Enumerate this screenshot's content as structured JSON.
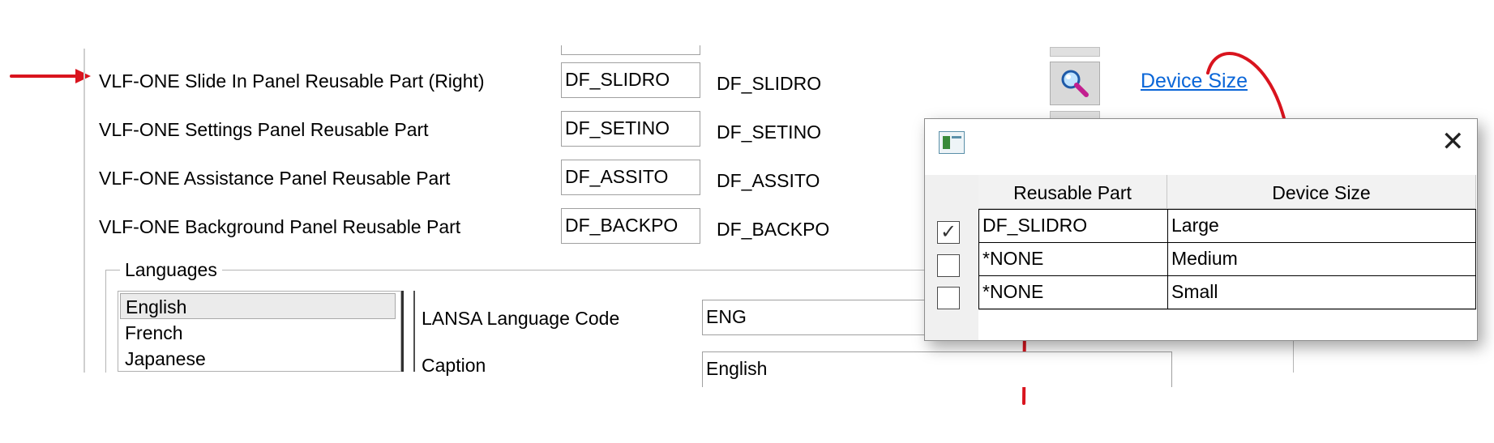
{
  "rows": [
    {
      "label": "VLF-ONE Slide In Panel Reusable Part (Right)",
      "input": "DF_SLIDRO",
      "value": "DF_SLIDRO"
    },
    {
      "label": "VLF-ONE Settings Panel Reusable Part",
      "input": "DF_SETINO",
      "value": "DF_SETINO"
    },
    {
      "label": "VLF-ONE Assistance Panel Reusable Part",
      "input": "DF_ASSITO",
      "value": "DF_ASSITO"
    },
    {
      "label": "VLF-ONE Background Panel Reusable Part",
      "input": "DF_BACKPO",
      "value": "DF_BACKPO"
    }
  ],
  "link": {
    "device_size": "Device Size"
  },
  "languages": {
    "title": "Languages",
    "items": [
      "English",
      "French",
      "Japanese"
    ],
    "selected": "English",
    "code_label": "LANSA Language Code",
    "code_value": "ENG",
    "caption_label": "Caption",
    "caption_value": "English"
  },
  "dialog": {
    "columns": [
      "Reusable Part",
      "Device Size"
    ],
    "rows": [
      {
        "checked": true,
        "check_glyph": "✓",
        "part": "DF_SLIDRO",
        "size": "Large"
      },
      {
        "checked": false,
        "check_glyph": "",
        "part": "*NONE",
        "size": "Medium"
      },
      {
        "checked": false,
        "check_glyph": "",
        "part": "*NONE",
        "size": "Small"
      }
    ],
    "close_glyph": "✕"
  },
  "icons": {
    "search": "search-icon",
    "dialog": "window-icon",
    "close": "close-icon",
    "annotation": "red-arrow-icon"
  },
  "colors": {
    "annotation": "#d9141e",
    "link": "#0a66d8"
  }
}
